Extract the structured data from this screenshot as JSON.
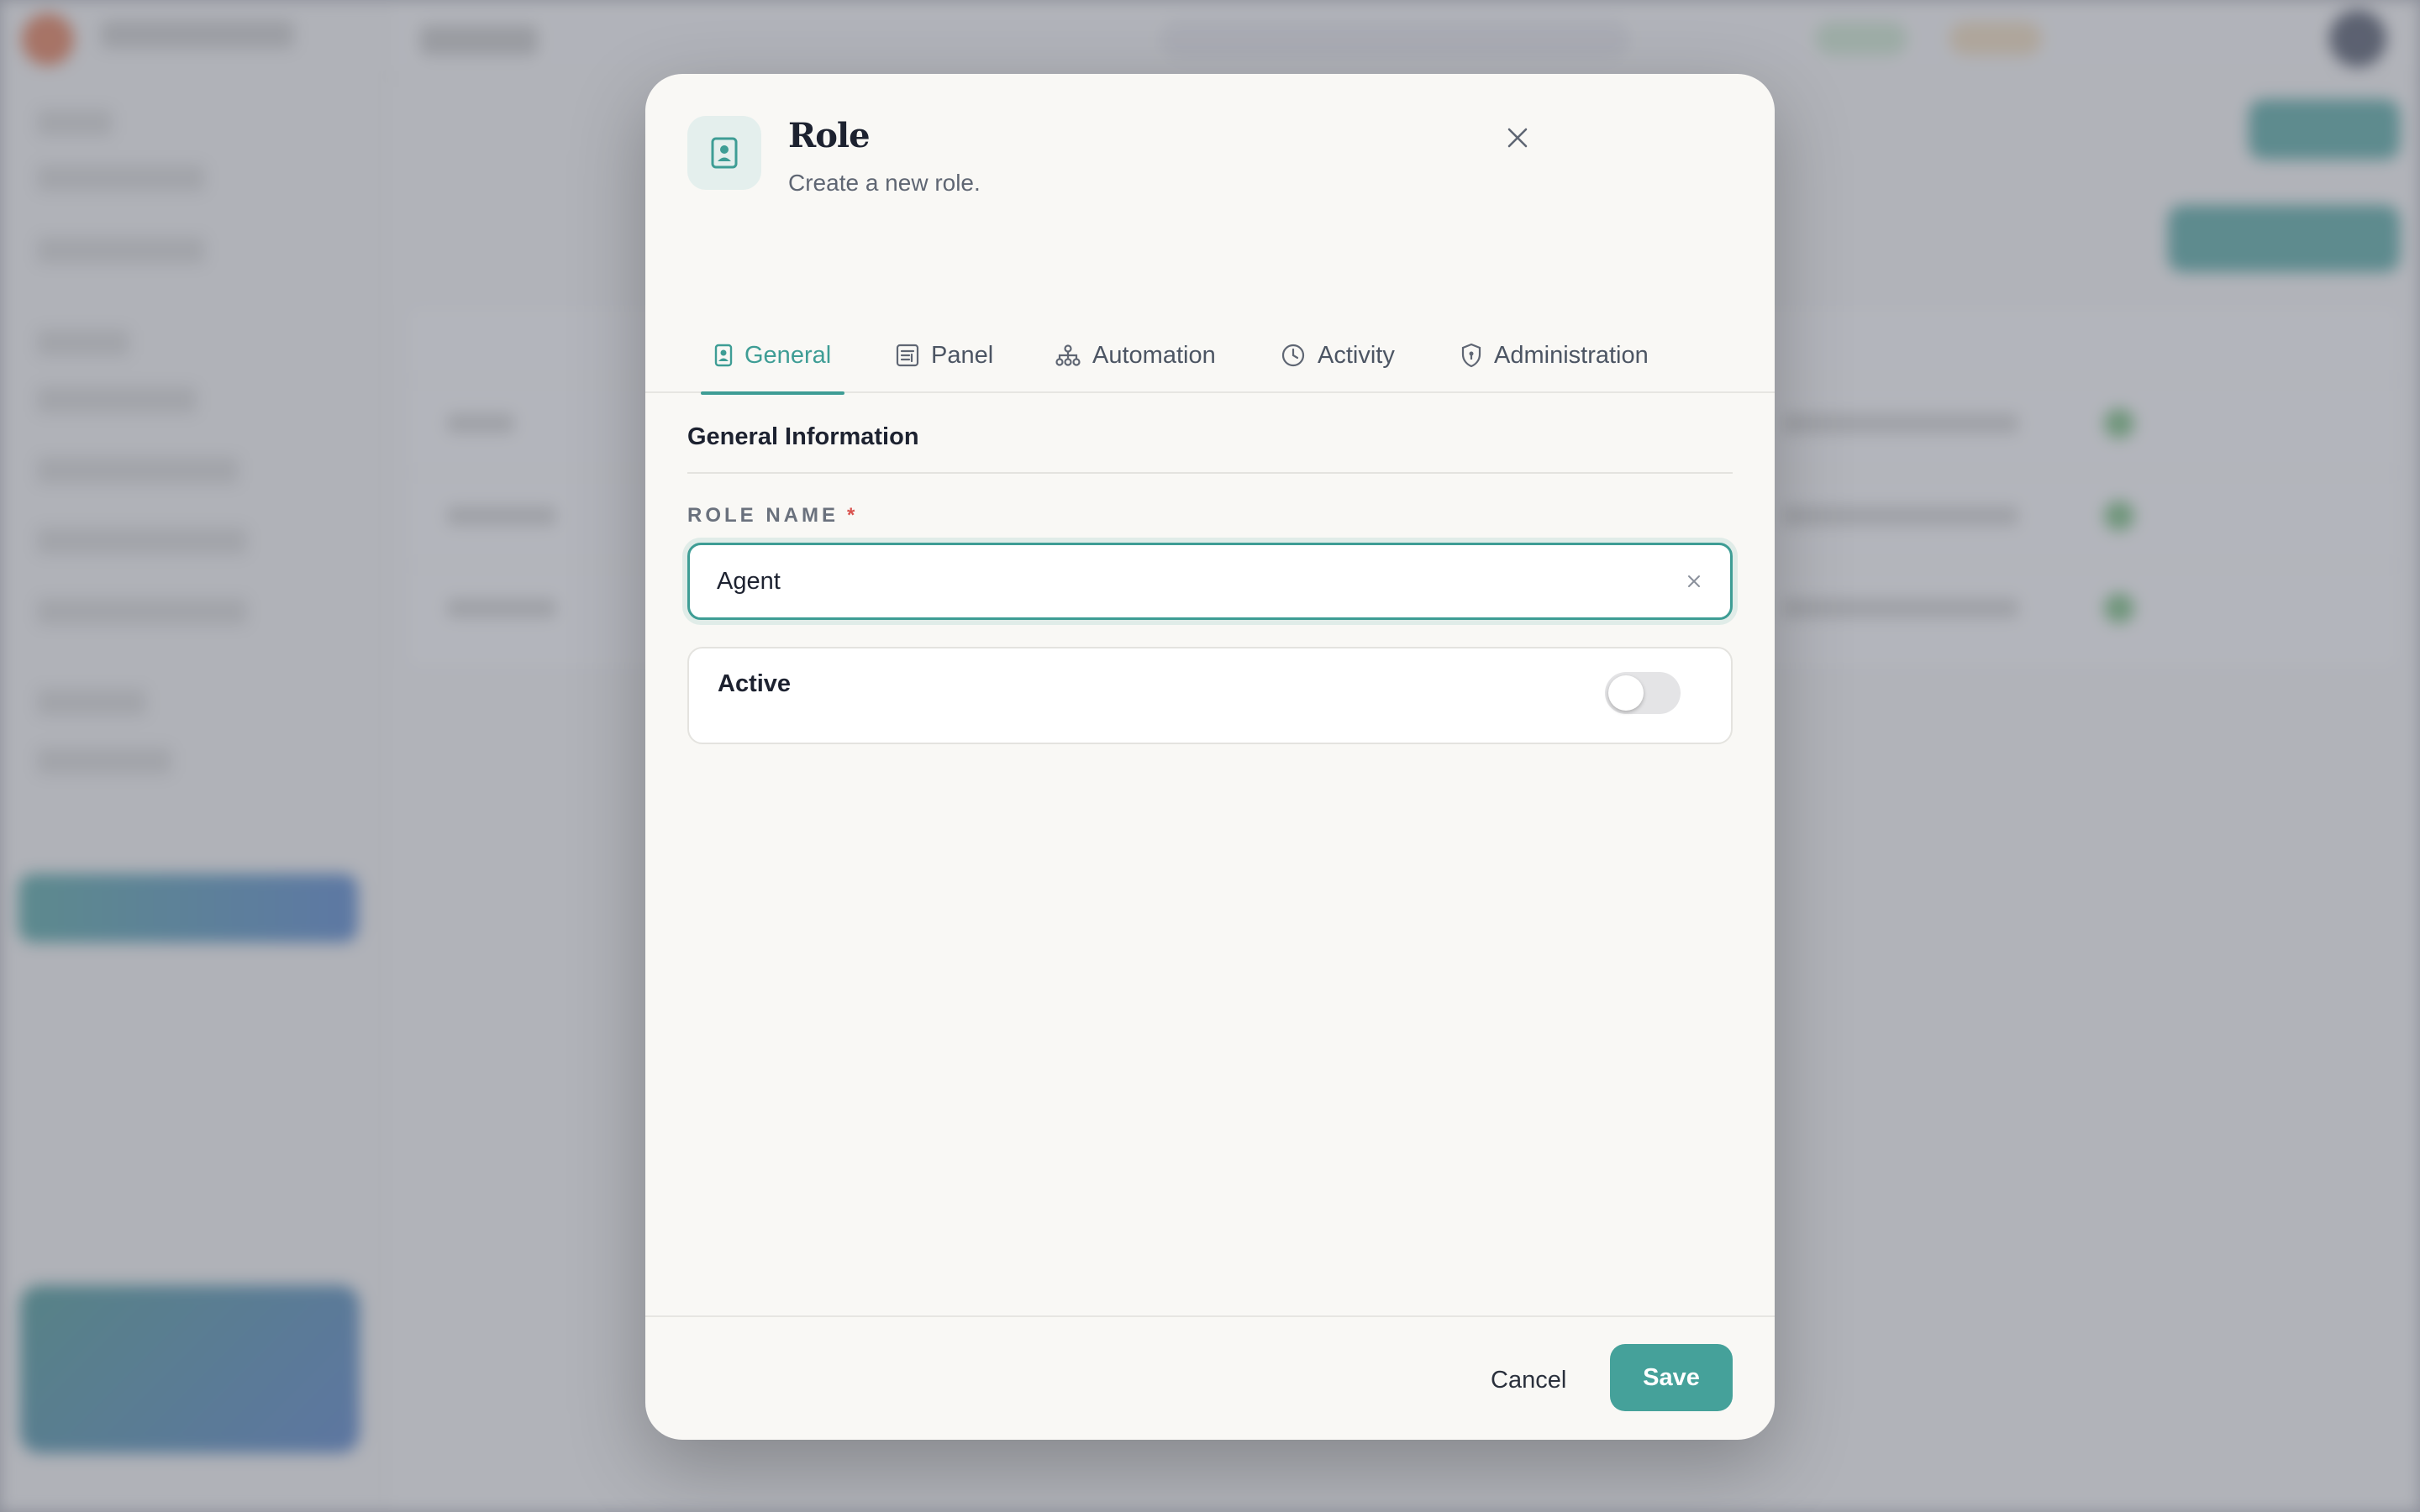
{
  "modal": {
    "title": "Role",
    "subtitle": "Create a new role.",
    "tabs": [
      {
        "label": "General",
        "icon": "id-badge-icon",
        "active": true
      },
      {
        "label": "Panel",
        "icon": "panel-icon",
        "active": false
      },
      {
        "label": "Automation",
        "icon": "sitemap-icon",
        "active": false
      },
      {
        "label": "Activity",
        "icon": "clock-icon",
        "active": false
      },
      {
        "label": "Administration",
        "icon": "shield-icon",
        "active": false
      }
    ],
    "section_title": "General Information",
    "role_name": {
      "label": "ROLE NAME",
      "required_mark": "*",
      "value": "Agent"
    },
    "active": {
      "label": "Active",
      "enabled": false
    },
    "footer": {
      "cancel_label": "Cancel",
      "save_label": "Save"
    }
  },
  "colors": {
    "accent": "#3e9d95",
    "required": "#d9534f",
    "text_primary": "#1d2230",
    "text_secondary": "#5f6673"
  }
}
